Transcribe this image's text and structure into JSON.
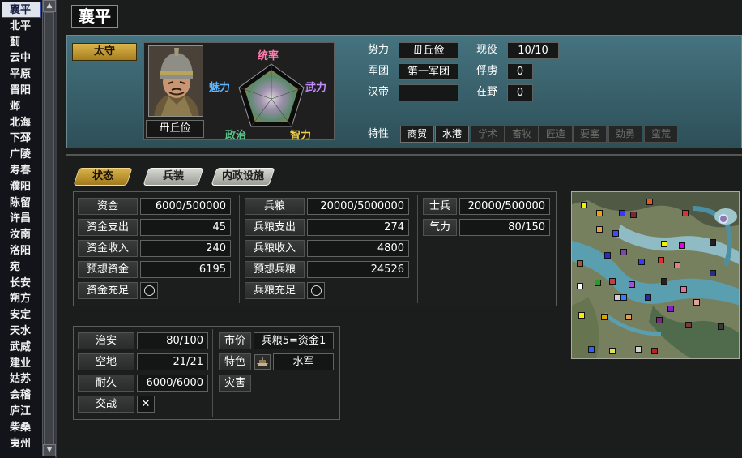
{
  "city_list": {
    "items": [
      "襄平",
      "北平",
      "蓟",
      "云中",
      "平原",
      "晋阳",
      "邺",
      "北海",
      "下邳",
      "广陵",
      "寿春",
      "濮阳",
      "陈留",
      "许昌",
      "汝南",
      "洛阳",
      "宛",
      "长安",
      "朔方",
      "安定",
      "天水",
      "武威",
      "建业",
      "姑苏",
      "会稽",
      "庐江",
      "柴桑",
      "夷州"
    ],
    "selected_index": 0,
    "scroll_up": "▲",
    "scroll_down": "▼"
  },
  "header": {
    "city_name": "襄平",
    "role": "太守",
    "officer_name": "毌丘俭",
    "stats": {
      "leadership": "统率",
      "war": "武力",
      "intelligence": "智力",
      "politics": "政治",
      "charm": "魅力"
    },
    "info": {
      "force_label": "势力",
      "force_value": "毌丘俭",
      "corps_label": "军团",
      "corps_value": "第一军团",
      "emperor_label": "汉帝",
      "emperor_value": "",
      "active_label": "现役",
      "active_value": "10/10",
      "captive_label": "俘虏",
      "captive_value": "0",
      "free_label": "在野",
      "free_value": "0"
    },
    "traits_label": "特性",
    "traits": [
      {
        "name": "商贸",
        "active": true
      },
      {
        "name": "水港",
        "active": true
      },
      {
        "name": "学术",
        "active": false
      },
      {
        "name": "畜牧",
        "active": false
      },
      {
        "name": "匠造",
        "active": false
      },
      {
        "name": "要塞",
        "active": false
      },
      {
        "name": "劲勇",
        "active": false
      },
      {
        "name": "蛮荒",
        "active": false
      }
    ]
  },
  "tabs": [
    {
      "label": "状态",
      "active": true
    },
    {
      "label": "兵装",
      "active": false
    },
    {
      "label": "内政设施",
      "active": false
    }
  ],
  "funds": {
    "rows": [
      {
        "label": "资金",
        "value": "6000/500000"
      },
      {
        "label": "资金支出",
        "value": "45"
      },
      {
        "label": "资金收入",
        "value": "240"
      },
      {
        "label": "预想资金",
        "value": "6195"
      },
      {
        "label": "资金充足",
        "value": "○"
      }
    ]
  },
  "food": {
    "rows": [
      {
        "label": "兵粮",
        "value": "20000/5000000"
      },
      {
        "label": "兵粮支出",
        "value": "274"
      },
      {
        "label": "兵粮收入",
        "value": "4800"
      },
      {
        "label": "预想兵粮",
        "value": "24526"
      },
      {
        "label": "兵粮充足",
        "value": "○"
      }
    ]
  },
  "troops": {
    "rows": [
      {
        "label": "士兵",
        "value": "20000/500000"
      },
      {
        "label": "气力",
        "value": "80/150"
      }
    ]
  },
  "city_status": {
    "rows": [
      {
        "label": "治安",
        "value": "80/100"
      },
      {
        "label": "空地",
        "value": "21/21"
      },
      {
        "label": "耐久",
        "value": "6000/6000"
      },
      {
        "label": "交战",
        "value": "✕"
      }
    ]
  },
  "market": {
    "price_label": "市价",
    "price_value": "兵粮5=资金1",
    "special_label": "特色",
    "special_value": "水军",
    "disaster_label": "灾害"
  },
  "colors": {
    "accent_gold": "#d9b24a",
    "panel_teal": "#3e6b77",
    "leadership": "#ff7fb0",
    "war": "#c38cff",
    "intelligence": "#f0d048",
    "politics": "#59c28a",
    "charm": "#5fb6ff"
  }
}
